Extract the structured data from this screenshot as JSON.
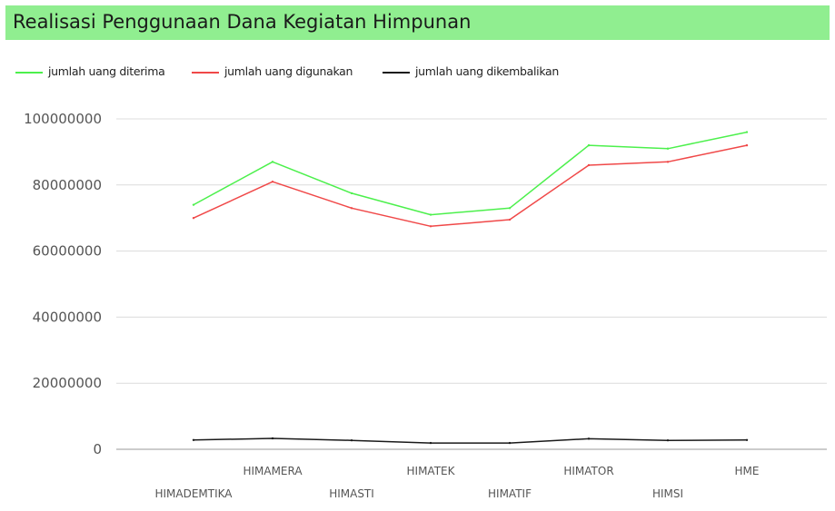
{
  "chart_data": {
    "type": "line",
    "title": "Realisasi Penggunaan Dana Kegiatan Himpunan",
    "xlabel": "",
    "ylabel": "",
    "categories": [
      "HIMADEMTIKA",
      "HIMAMERA",
      "HIMASTI",
      "HIMATEK",
      "HIMATIF",
      "HIMATOR",
      "HIMSI",
      "HME"
    ],
    "ylim": [
      0,
      100000000
    ],
    "yticks": [
      "0",
      "20000000",
      "40000000",
      "60000000",
      "80000000",
      "100000000"
    ],
    "grid": true,
    "legend_position": "top-left",
    "series": [
      {
        "name": "jumlah uang diterima",
        "color": "#4cf04c",
        "values": [
          74000000,
          87000000,
          77500000,
          71000000,
          73000000,
          92000000,
          91000000,
          96000000
        ]
      },
      {
        "name": "jumlah uang digunakan",
        "color": "#f04848",
        "values": [
          70000000,
          81000000,
          73000000,
          67500000,
          69500000,
          86000000,
          87000000,
          92000000
        ]
      },
      {
        "name": "jumlah uang dikembalikan",
        "color": "#1a1a1a",
        "values": [
          2800000,
          3300000,
          2700000,
          1900000,
          1900000,
          3200000,
          2700000,
          2800000
        ]
      }
    ]
  }
}
